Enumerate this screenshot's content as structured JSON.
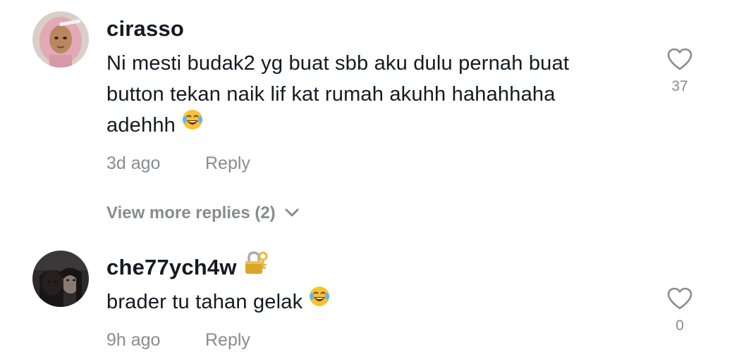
{
  "comments": [
    {
      "username": "cirasso",
      "text": "Ni mesti budak2 yg buat sbb aku dulu pernah buat button tekan naik lif kat rumah akuhh hahahhaha adehhh",
      "text_emoji": "face-with-tears-of-joy-emoji",
      "time": "3d ago",
      "reply_label": "Reply",
      "like_count": "37",
      "view_more_label": "View more replies (2)"
    },
    {
      "username": "che77ych4w",
      "username_emoji": "locked-with-key-emoji",
      "text": "brader tu tahan gelak",
      "text_emoji": "face-with-tears-of-joy-emoji",
      "time": "9h ago",
      "reply_label": "Reply",
      "like_count": "0"
    }
  ],
  "colors": {
    "text_primary": "#161823",
    "text_secondary": "#8a8b91",
    "background": "#ffffff"
  }
}
